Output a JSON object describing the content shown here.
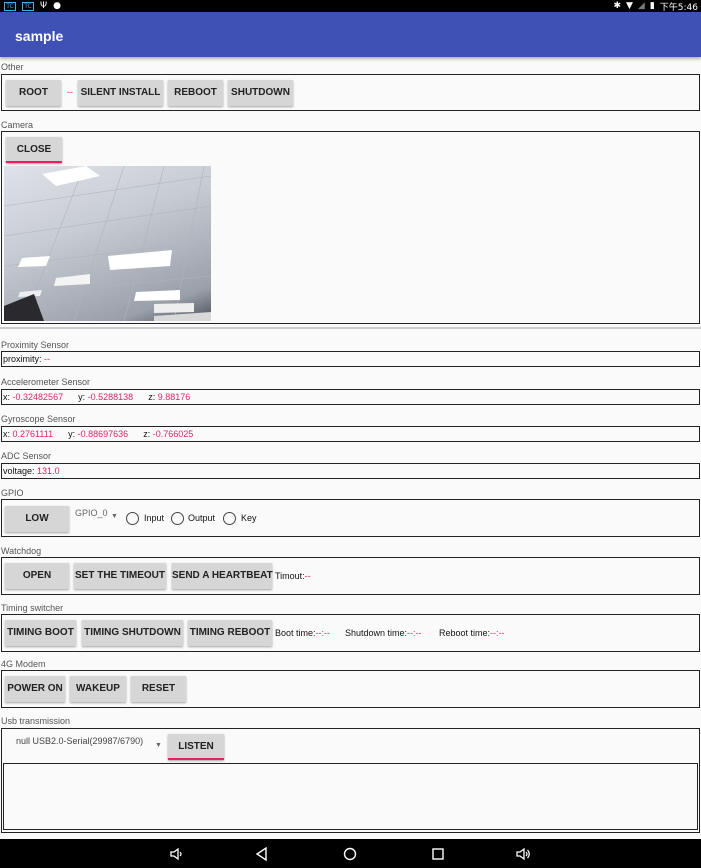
{
  "status": {
    "left_icons": [
      "app-icon",
      "app-icon",
      "usb-icon",
      "debug-icon"
    ],
    "badge1": "TC",
    "badge2": "TC",
    "time": "下午5:46"
  },
  "appbar": {
    "title": "sample"
  },
  "other": {
    "label": "Other",
    "root": "ROOT",
    "root_status": "--",
    "silent_install": "SILENT INSTALL",
    "reboot": "REBOOT",
    "shutdown": "SHUTDOWN"
  },
  "camera": {
    "label": "Camera",
    "close": "CLOSE"
  },
  "proximity": {
    "label": "Proximity Sensor",
    "key": "proximity:",
    "value": "--"
  },
  "accel": {
    "label": "Accelerometer Sensor",
    "x_key": "x:",
    "x": "-0.32482567",
    "y_key": "y:",
    "y": "-0.5288138",
    "z_key": "z:",
    "z": "9.88176"
  },
  "gyro": {
    "label": "Gyroscope Sensor",
    "x_key": "x:",
    "x": "0.2761111",
    "y_key": "y:",
    "y": "-0.88697636",
    "z_key": "z:",
    "z": "-0.766025"
  },
  "adc": {
    "label": "ADC Sensor",
    "key": "voltage:",
    "value": "131.0"
  },
  "gpio": {
    "label": "GPIO",
    "level": "LOW",
    "pin": "GPIO_0",
    "input": "Input",
    "output": "Output",
    "key": "Key"
  },
  "watchdog": {
    "label": "Watchdog",
    "open": "OPEN",
    "set_timeout": "SET THE TIMEOUT",
    "heartbeat": "SEND A HEARTBEAT",
    "timeout_key": "Timout:",
    "timeout_value": "--"
  },
  "timing": {
    "label": "Timing switcher",
    "boot": "TIMING BOOT",
    "shutdown": "TIMING SHUTDOWN",
    "reboot": "TIMING REBOOT",
    "boot_key": "Boot time:",
    "boot_value": "--:--",
    "shutdown_key": "Shutdown time:",
    "shutdown_value": "--:--",
    "reboot_key": "Reboot time:",
    "reboot_value": "--:--"
  },
  "modem": {
    "label": "4G Modem",
    "power_on": "POWER ON",
    "wakeup": "WAKEUP",
    "reset": "RESET"
  },
  "usb": {
    "label": "Usb transmission",
    "device": "null USB2.0-Serial(29987/6790)",
    "listen": "LISTEN"
  },
  "colors": {
    "appbar": "#3f51b5",
    "accent": "#e91e63"
  }
}
